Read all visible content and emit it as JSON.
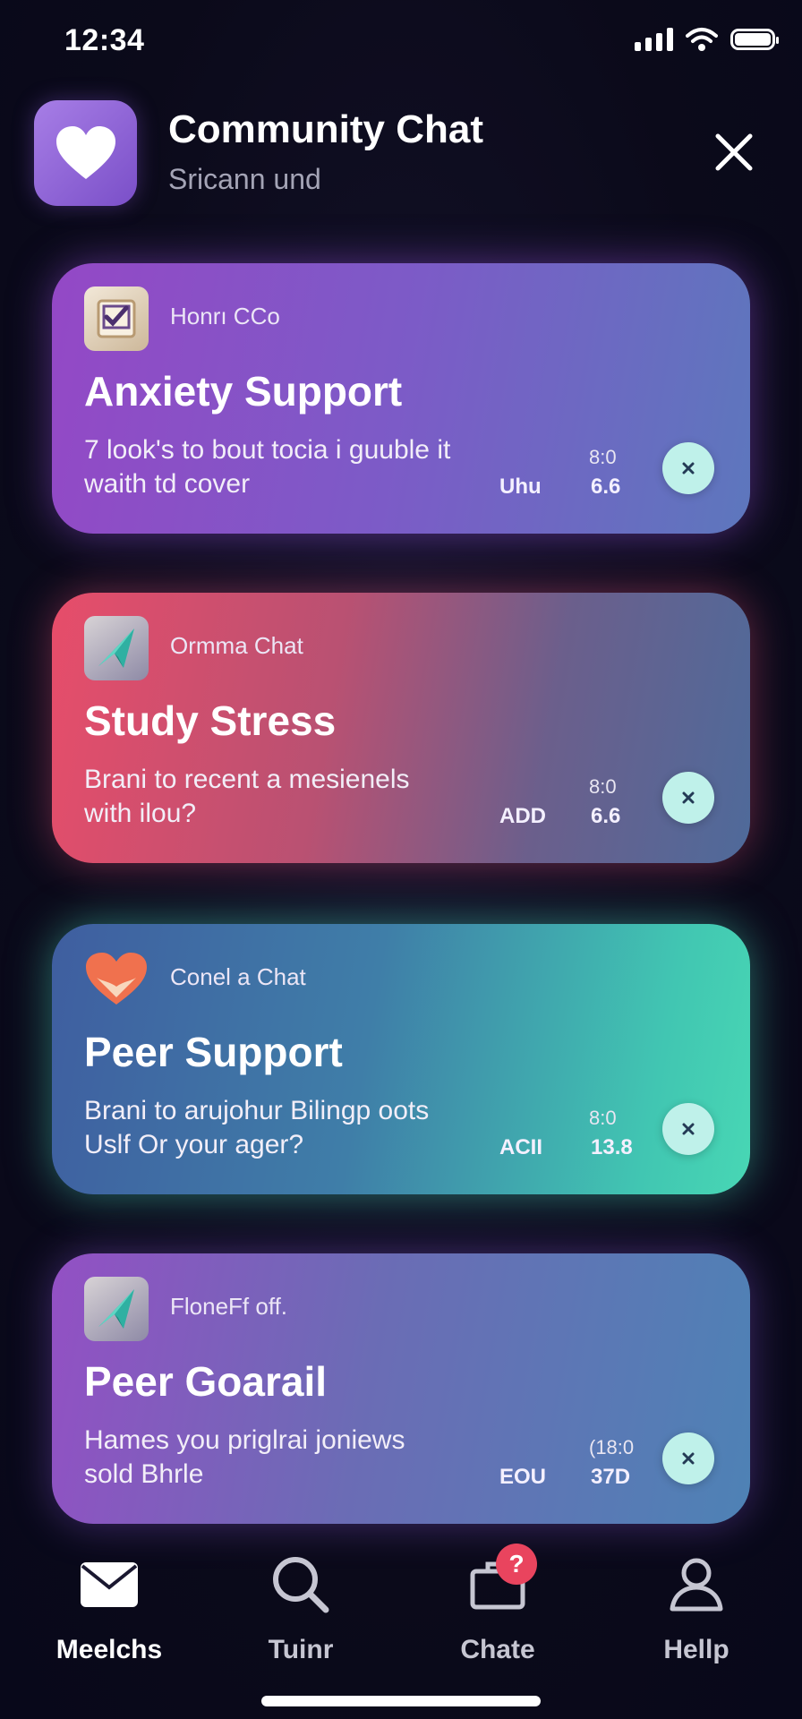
{
  "status_bar": {
    "time": "12:34"
  },
  "header": {
    "title": "Community Chat",
    "subtitle": "Sricann und"
  },
  "cards": [
    {
      "eyebrow": "Honrı CCo",
      "title": "Anxiety Support",
      "body_line1": "7 look's to bout tocia i guuble it",
      "body_line2": "waith td cover",
      "stat_top": "8:0",
      "stat_label": "Uhu",
      "stat_value": "6.6",
      "icon": "checklist-icon"
    },
    {
      "eyebrow": "Ormma Chat",
      "title": "Study Stress",
      "body_line1": "Brani to recent a mesienels",
      "body_line2": "with ilou?",
      "stat_top": "8:0",
      "stat_label": "ADD",
      "stat_value": "6.6",
      "icon": "paper-plane-icon"
    },
    {
      "eyebrow": "Conel a Chat",
      "title": "Peer Support",
      "body_line1": "Brani to arujohur Bilingp oots",
      "body_line2": "Uslf Or your ager?",
      "stat_top": "8:0",
      "stat_label": "ACII",
      "stat_value": "13.8",
      "icon": "heart-hands-icon"
    },
    {
      "eyebrow": "FloneFf off.",
      "title": "Peer Goarail",
      "body_line1": "Hames you priglrai joniews",
      "body_line2": "sold Bhrle",
      "stat_top": "(18:0",
      "stat_label": "EOU",
      "stat_value": "37D",
      "icon": "paper-plane-icon"
    }
  ],
  "nav": [
    {
      "label": "Meelchs",
      "icon": "mail-icon",
      "active": true
    },
    {
      "label": "Tuinr",
      "icon": "search-icon"
    },
    {
      "label": "Chate",
      "icon": "briefcase-icon",
      "badge": "?"
    },
    {
      "label": "Hellp",
      "icon": "person-icon"
    }
  ],
  "colors": {
    "background": "#0b0a1a",
    "badge": "#e9445e",
    "dismiss": "#bff1ea"
  }
}
